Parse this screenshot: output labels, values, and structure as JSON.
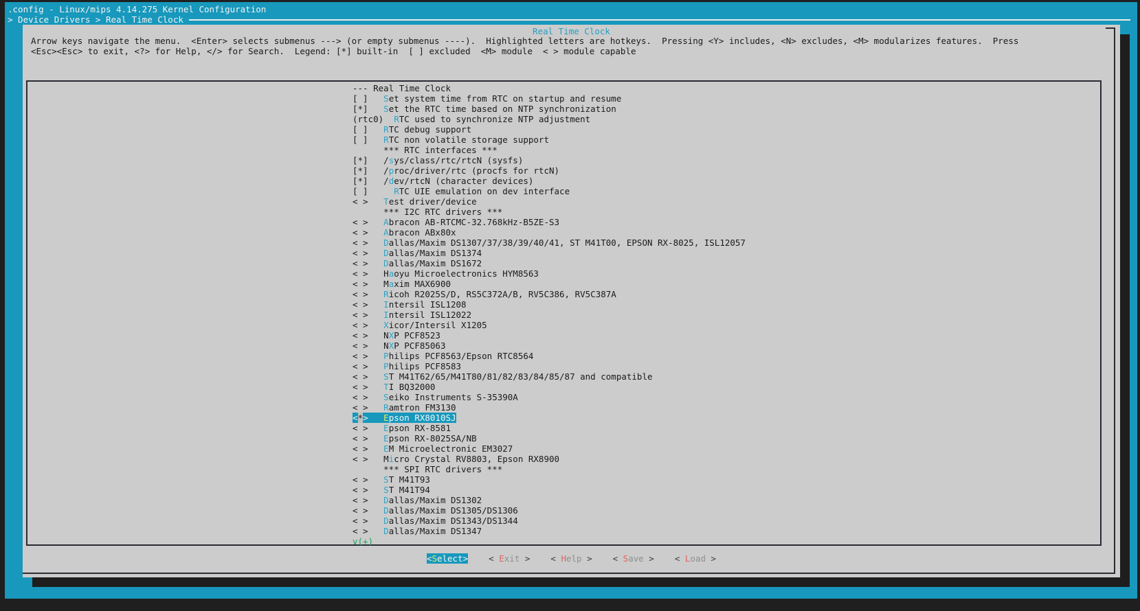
{
  "titlebar": ".config - Linux/mips 4.14.275 Kernel Configuration",
  "breadcrumb": "> Device Drivers > Real Time Clock",
  "dialog": {
    "title": "Real Time Clock",
    "instructions_line1": "Arrow keys navigate the menu.  <Enter> selects submenus ---> (or empty submenus ----).  Highlighted letters are hotkeys.  Pressing <Y> includes, <N> excludes, <M> modularizes features.  Press",
    "instructions_line2": "<Esc><Esc> to exit, <?> for Help, </> for Search.  Legend: [*] built-in  [ ] excluded  <M> module  < > module capable",
    "items": [
      {
        "type": "header",
        "text": "--- Real Time Clock"
      },
      {
        "type": "option",
        "tag": "[ ]",
        "label": "Set system time from RTC on startup and resume",
        "hotkey_index": 0
      },
      {
        "type": "option",
        "tag": "[*]",
        "label": "Set the RTC time based on NTP synchronization",
        "hotkey_index": 0
      },
      {
        "type": "value",
        "tag": "(rtc0)",
        "label": "RTC used to synchronize NTP adjustment",
        "hotkey_index": 0
      },
      {
        "type": "option",
        "tag": "[ ]",
        "label": "RTC debug support",
        "hotkey_index": 0
      },
      {
        "type": "option",
        "tag": "[ ]",
        "label": "RTC non volatile storage support",
        "hotkey_index": 0
      },
      {
        "type": "section",
        "text": "*** RTC interfaces ***"
      },
      {
        "type": "option",
        "tag": "[*]",
        "label": "/sys/class/rtc/rtcN (sysfs)",
        "hotkey_index": 1
      },
      {
        "type": "option",
        "tag": "[*]",
        "label": "/proc/driver/rtc (procfs for rtcN)",
        "hotkey_index": 1
      },
      {
        "type": "option",
        "tag": "[*]",
        "label": "/dev/rtcN (character devices)",
        "hotkey_index": 1
      },
      {
        "type": "option",
        "tag": "[ ]",
        "label": "RTC UIE emulation on dev interface",
        "hotkey_index": 0,
        "indent": 2
      },
      {
        "type": "option",
        "tag": "< >",
        "label": "Test driver/device",
        "hotkey_index": 0
      },
      {
        "type": "section",
        "text": "*** I2C RTC drivers ***"
      },
      {
        "type": "option",
        "tag": "< >",
        "label": "Abracon AB-RTCMC-32.768kHz-B5ZE-S3",
        "hotkey_index": 0
      },
      {
        "type": "option",
        "tag": "< >",
        "label": "Abracon ABx80x",
        "hotkey_index": 0
      },
      {
        "type": "option",
        "tag": "< >",
        "label": "Dallas/Maxim DS1307/37/38/39/40/41, ST M41T00, EPSON RX-8025, ISL12057",
        "hotkey_index": 0
      },
      {
        "type": "option",
        "tag": "< >",
        "label": "Dallas/Maxim DS1374",
        "hotkey_index": 0
      },
      {
        "type": "option",
        "tag": "< >",
        "label": "Dallas/Maxim DS1672",
        "hotkey_index": 0
      },
      {
        "type": "option",
        "tag": "< >",
        "label": "Haoyu Microelectronics HYM8563",
        "hotkey_index": 1
      },
      {
        "type": "option",
        "tag": "< >",
        "label": "Maxim MAX6900",
        "hotkey_index": 1
      },
      {
        "type": "option",
        "tag": "< >",
        "label": "Ricoh R2025S/D, RS5C372A/B, RV5C386, RV5C387A",
        "hotkey_index": 0
      },
      {
        "type": "option",
        "tag": "< >",
        "label": "Intersil ISL1208",
        "hotkey_index": 0
      },
      {
        "type": "option",
        "tag": "< >",
        "label": "Intersil ISL12022",
        "hotkey_index": 0
      },
      {
        "type": "option",
        "tag": "< >",
        "label": "Xicor/Intersil X1205",
        "hotkey_index": 0
      },
      {
        "type": "option",
        "tag": "< >",
        "label": "NXP PCF8523",
        "hotkey_index": 1
      },
      {
        "type": "option",
        "tag": "< >",
        "label": "NXP PCF85063",
        "hotkey_index": 1
      },
      {
        "type": "option",
        "tag": "< >",
        "label": "Philips PCF8563/Epson RTC8564",
        "hotkey_index": 0
      },
      {
        "type": "option",
        "tag": "< >",
        "label": "Philips PCF8583",
        "hotkey_index": 0
      },
      {
        "type": "option",
        "tag": "< >",
        "label": "ST M41T62/65/M41T80/81/82/83/84/85/87 and compatible",
        "hotkey_index": 0
      },
      {
        "type": "option",
        "tag": "< >",
        "label": "TI BQ32000",
        "hotkey_index": 0
      },
      {
        "type": "option",
        "tag": "< >",
        "label": "Seiko Instruments S-35390A",
        "hotkey_index": 0
      },
      {
        "type": "option",
        "tag": "< >",
        "label": "Ramtron FM3130",
        "hotkey_index": 0
      },
      {
        "type": "option",
        "tag": "<*>",
        "label": "Epson RX8010SJ",
        "hotkey_index": 0,
        "selected": true
      },
      {
        "type": "option",
        "tag": "< >",
        "label": "Epson RX-8581",
        "hotkey_index": 0
      },
      {
        "type": "option",
        "tag": "< >",
        "label": "Epson RX-8025SA/NB",
        "hotkey_index": 0
      },
      {
        "type": "option",
        "tag": "< >",
        "label": "EM Microelectronic EM3027",
        "hotkey_index": 0
      },
      {
        "type": "option",
        "tag": "< >",
        "label": "Micro Crystal RV8803, Epson RX8900",
        "hotkey_index": 1
      },
      {
        "type": "section",
        "text": "*** SPI RTC drivers ***"
      },
      {
        "type": "option",
        "tag": "< >",
        "label": "ST M41T93",
        "hotkey_index": 0
      },
      {
        "type": "option",
        "tag": "< >",
        "label": "ST M41T94",
        "hotkey_index": 0
      },
      {
        "type": "option",
        "tag": "< >",
        "label": "Dallas/Maxim DS1302",
        "hotkey_index": 0
      },
      {
        "type": "option",
        "tag": "< >",
        "label": "Dallas/Maxim DS1305/DS1306",
        "hotkey_index": 0
      },
      {
        "type": "option",
        "tag": "< >",
        "label": "Dallas/Maxim DS1343/DS1344",
        "hotkey_index": 0
      },
      {
        "type": "option",
        "tag": "< >",
        "label": "Dallas/Maxim DS1347",
        "hotkey_index": 0
      },
      {
        "type": "scroll",
        "text": "v(+)"
      }
    ],
    "buttons": [
      {
        "label": "Select",
        "hotkey_index": 0,
        "selected": true,
        "padded": false
      },
      {
        "label": "Exit",
        "hotkey_index": 0,
        "padded": true
      },
      {
        "label": "Help",
        "hotkey_index": 0,
        "padded": true
      },
      {
        "label": "Save",
        "hotkey_index": 0,
        "padded": true
      },
      {
        "label": "Load",
        "hotkey_index": 0,
        "padded": true
      }
    ]
  },
  "colors": {
    "accent_cyan": "#1798BC",
    "dialog_bg": "#CCCCCC",
    "shadow": "#1E1E1E",
    "title_text_cyan": "#259FC4",
    "hotkey_cyan": "#2FA3C6",
    "hotkey_yellow": "#E9E959",
    "button_hotkey_red": "#E2625E",
    "scroll_green": "#18A45F",
    "selection_text": "#F5F5F5"
  }
}
